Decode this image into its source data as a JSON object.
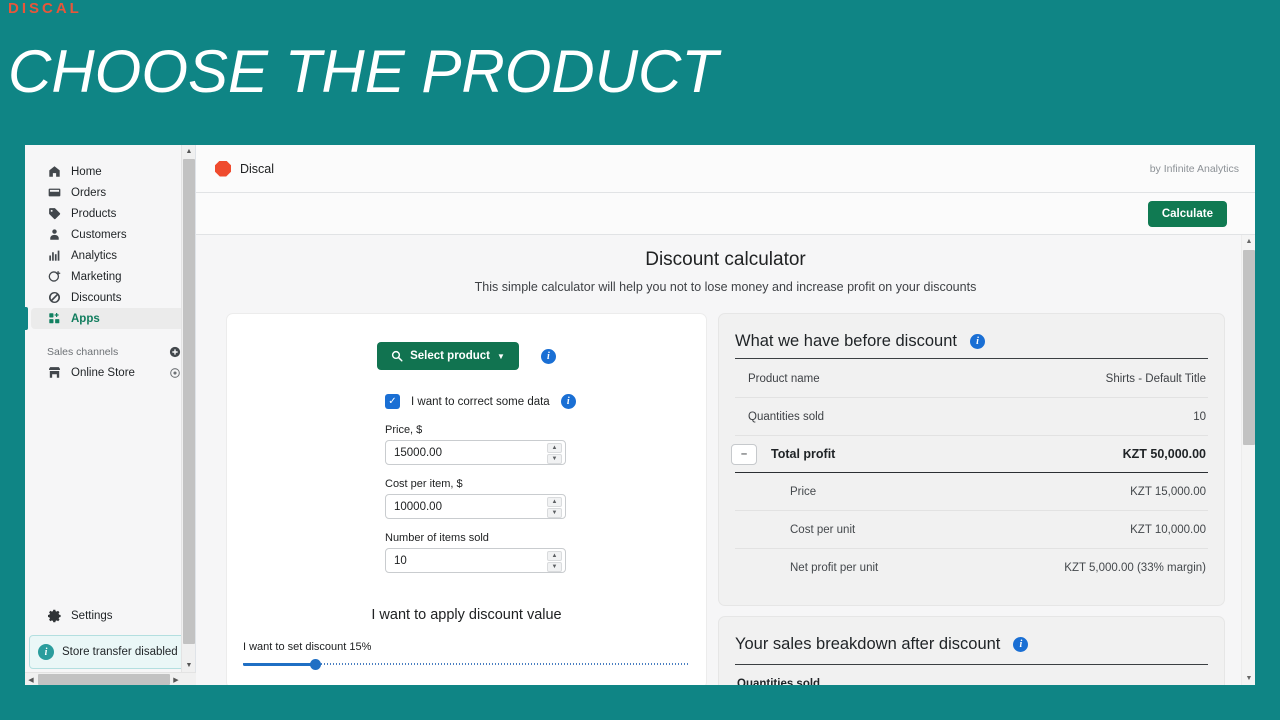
{
  "promo": {
    "brand": "DISCAL",
    "headline": "CHOOSE THE PRODUCT",
    "background_color": "#0f8585",
    "brand_color": "#e8563a"
  },
  "sidebar": {
    "items": [
      {
        "label": "Home",
        "icon": "home-icon"
      },
      {
        "label": "Orders",
        "icon": "orders-icon"
      },
      {
        "label": "Products",
        "icon": "products-tag-icon"
      },
      {
        "label": "Customers",
        "icon": "customers-person-icon"
      },
      {
        "label": "Analytics",
        "icon": "analytics-bars-icon"
      },
      {
        "label": "Marketing",
        "icon": "marketing-target-icon"
      },
      {
        "label": "Discounts",
        "icon": "discounts-icon"
      },
      {
        "label": "Apps",
        "icon": "apps-grid-icon",
        "active": true
      }
    ],
    "sales_channels": {
      "label": "Sales channels",
      "add_icon": "plus-circle-icon",
      "channels": [
        {
          "label": "Online Store",
          "icon": "storefront-icon",
          "trailing_icon": "eye-icon"
        }
      ]
    },
    "settings": {
      "label": "Settings",
      "icon": "gear-icon"
    },
    "store_banner": {
      "label": "Store transfer disabled",
      "icon": "info-icon"
    },
    "accent_color": "#117d5e"
  },
  "app": {
    "brand_name": "Discal",
    "brand_icon": "discal-hexagon-logo",
    "byline": "by Infinite Analytics",
    "calculate_label": "Calculate",
    "calculate_color": "#107a52"
  },
  "main": {
    "title": "Discount calculator",
    "subtitle": "This simple calculator will help you not to lose money and increase profit on your discounts",
    "form": {
      "select_product_label": "Select product",
      "select_product_icon": "search-icon",
      "select_product_caret": "chevron-down-icon",
      "select_info_icon": "info-icon",
      "correct_data_label": "I want to correct some data",
      "correct_data_checked": true,
      "correct_data_info_icon": "info-icon",
      "fields": [
        {
          "label": "Price, $",
          "value": "15000.00",
          "placeholder": "0.00"
        },
        {
          "label": "Cost per item, $",
          "value": "10000.00",
          "placeholder": "0.00"
        },
        {
          "label": "Number of items sold",
          "value": "10",
          "placeholder": "0"
        }
      ],
      "apply_title": "I want to apply discount value",
      "slider_label": "I want to set discount 15%",
      "slider_value": 15,
      "slider_min": 0,
      "slider_max": 100,
      "slider_color": "#1f6fc4"
    },
    "before_card": {
      "heading": "What we have before discount",
      "info_icon": "info-icon",
      "rows": [
        {
          "key": "Product name",
          "value": "Shirts - Default Title"
        },
        {
          "key": "Quantities sold",
          "value": "10"
        }
      ],
      "total": {
        "key": "Total profit",
        "value": "KZT 50,000.00",
        "collapse_icon": "minus-icon"
      },
      "sub_rows": [
        {
          "key": "Price",
          "value": "KZT 15,000.00"
        },
        {
          "key": "Cost per unit",
          "value": "KZT 10,000.00"
        },
        {
          "key": "Net profit per unit",
          "value": "KZT 5,000.00 (33% margin)"
        }
      ]
    },
    "after_card": {
      "heading": "Your sales breakdown after discount",
      "info_icon": "info-icon",
      "rows": [
        {
          "key": "Quantities sold",
          "value": ""
        }
      ]
    }
  }
}
